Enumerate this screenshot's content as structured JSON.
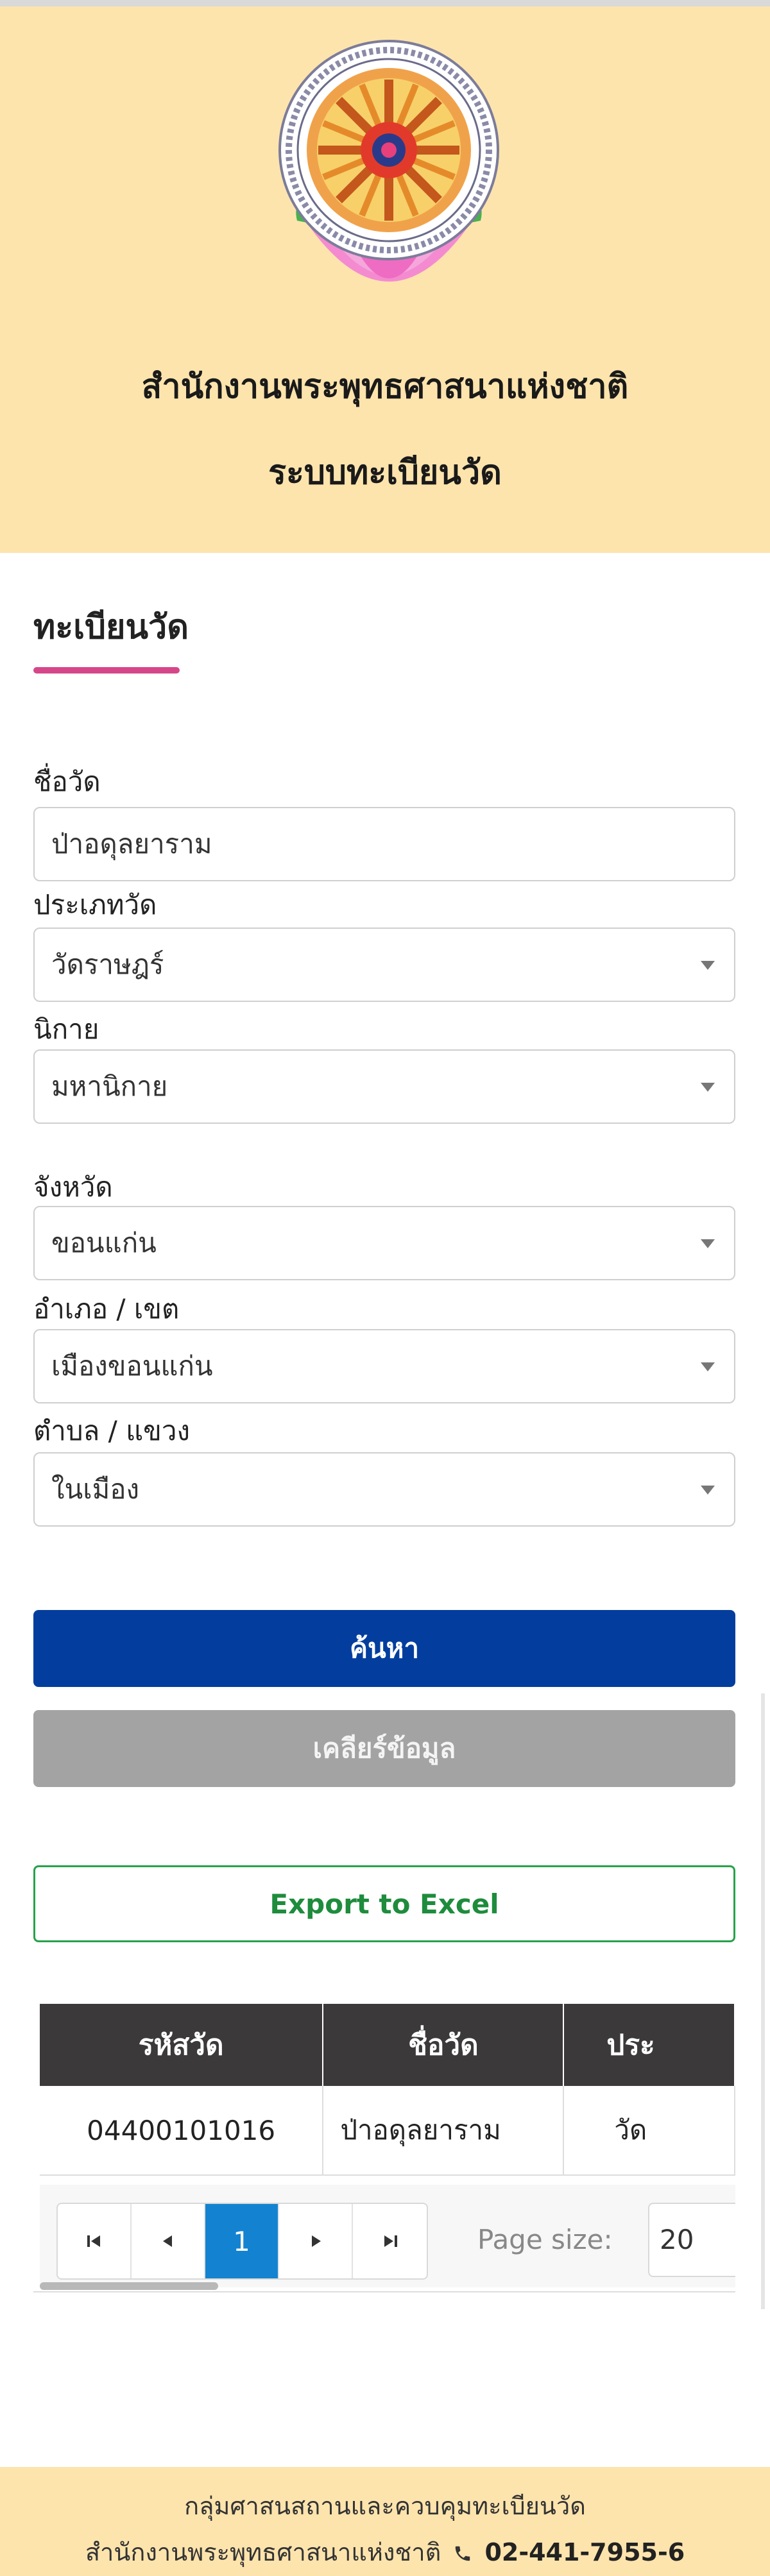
{
  "header": {
    "org_name": "สำนักงานพระพุทธศาสนาแห่งชาติ",
    "system_name": "ระบบทะเบียนวัด"
  },
  "form": {
    "title": "ทะเบียนวัด",
    "temple_name": {
      "label": "ชื่อวัด",
      "value": "ป่าอดุลยาราม"
    },
    "temple_type": {
      "label": "ประเภทวัด",
      "value": "วัดราษฎร์"
    },
    "sect": {
      "label": "นิกาย",
      "value": "มหานิกาย"
    },
    "province": {
      "label": "จังหวัด",
      "value": "ขอนแก่น"
    },
    "district": {
      "label": "อำเภอ / เขต",
      "value": "เมืองขอนแก่น"
    },
    "subdistrict": {
      "label": "ตำบล / แขวง",
      "value": "ในเมือง"
    }
  },
  "buttons": {
    "search": "ค้นหา",
    "clear": "เคลียร์ข้อมูล",
    "export": "Export to Excel"
  },
  "table": {
    "headers": [
      "รหัสวัด",
      "ชื่อวัด",
      "ประ"
    ],
    "rows": [
      [
        "04400101016",
        "ป่าอดุลยาราม",
        "วัด"
      ]
    ]
  },
  "pager": {
    "first_icon": "first-page-icon",
    "prev_icon": "prev-page-icon",
    "current_page": "1",
    "next_icon": "next-page-icon",
    "last_icon": "last-page-icon",
    "page_size_label": "Page size:",
    "page_size_value": "20"
  },
  "footer": {
    "line1": "กลุ่มศาสนสถานและควบคุมทะเบียนวัด",
    "org": "สำนักงานพระพุทธศาสนาแห่งชาติ",
    "phone": "02-441-7955-6",
    "phone_icon": "phone-icon"
  },
  "colors": {
    "header_bg": "#fde4ad",
    "accent_underline": "#d6478a",
    "search_button": "#033e9e",
    "clear_button": "#a3a3a3",
    "export_border": "#27a24a",
    "active_page": "#1383d1"
  }
}
